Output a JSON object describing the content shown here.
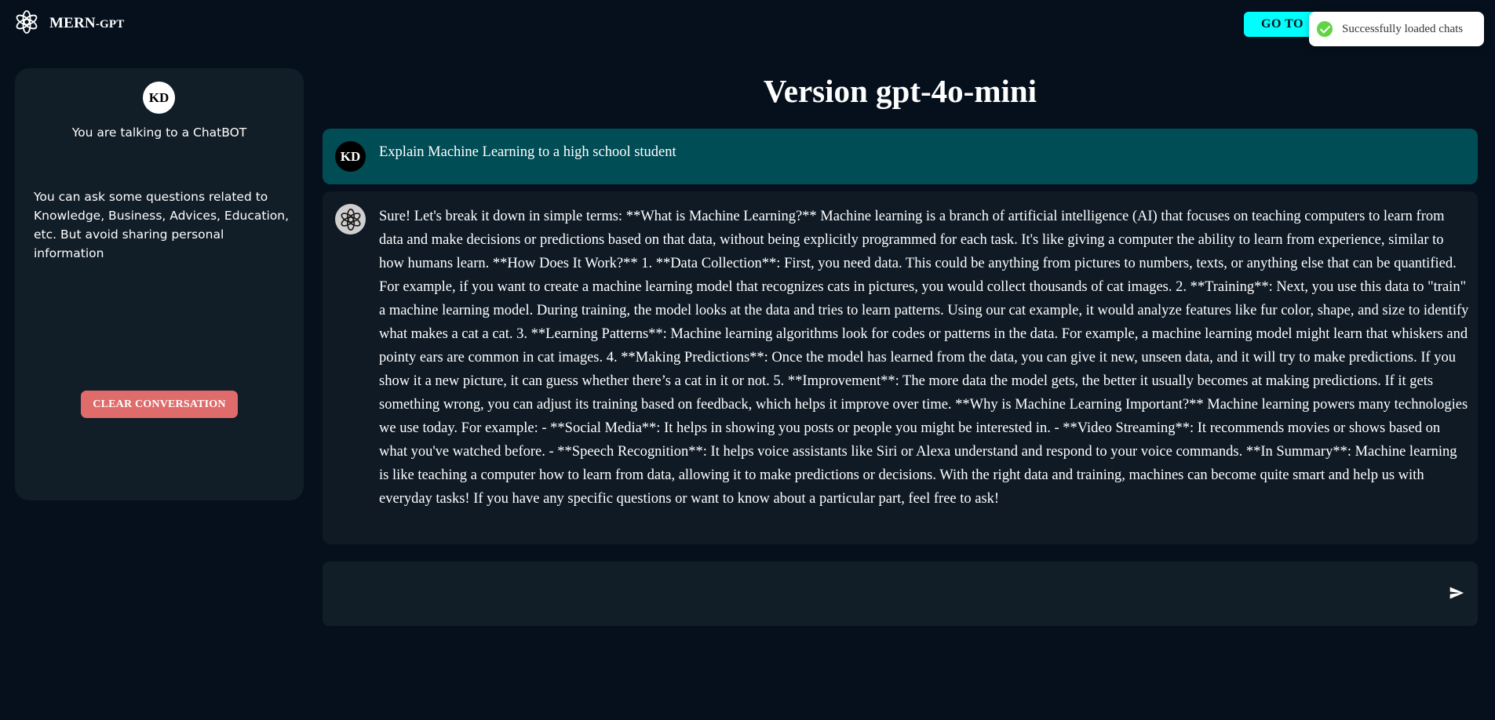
{
  "header": {
    "brand_main": "MERN",
    "brand_sub": "-GPT",
    "goto_button": "GO TO",
    "logo_icon": "openai-logo-icon"
  },
  "toast": {
    "message": "Successfully loaded chats",
    "icon": "check-circle-icon",
    "color": "#61d345"
  },
  "sidebar": {
    "avatar_initials": "KD",
    "title": "You are talking to a ChatBOT",
    "description": "You can ask some questions related to Knowledge, Business, Advices, Education, etc. But avoid sharing personal information",
    "clear_button": "CLEAR CONVERSATION"
  },
  "main": {
    "version_title": "Version gpt-4o-mini",
    "messages": [
      {
        "role": "user",
        "avatar": "KD",
        "text": "Explain Machine Learning to a high school student"
      },
      {
        "role": "assistant",
        "avatar_icon": "openai-logo-icon",
        "text": "Sure! Let's break it down in simple terms: **What is Machine Learning?** Machine learning is a branch of artificial intelligence (AI) that focuses on teaching computers to learn from data and make decisions or predictions based on that data, without being explicitly programmed for each task. It's like giving a computer the ability to learn from experience, similar to how humans learn. **How Does It Work?** 1. **Data Collection**: First, you need data. This could be anything from pictures to numbers, texts, or anything else that can be quantified. For example, if you want to create a machine learning model that recognizes cats in pictures, you would collect thousands of cat images. 2. **Training**: Next, you use this data to \"train\" a machine learning model. During training, the model looks at the data and tries to learn patterns. Using our cat example, it would analyze features like fur color, shape, and size to identify what makes a cat a cat. 3. **Learning Patterns**: Machine learning algorithms look for codes or patterns in the data. For example, a machine learning model might learn that whiskers and pointy ears are common in cat images. 4. **Making Predictions**: Once the model has learned from the data, you can give it new, unseen data, and it will try to make predictions. If you show it a new picture, it can guess whether there’s a cat in it or not. 5. **Improvement**: The more data the model gets, the better it usually becomes at making predictions. If it gets something wrong, you can adjust its training based on feedback, which helps it improve over time. **Why is Machine Learning Important?** Machine learning powers many technologies we use today. For example: - **Social Media**: It helps in showing you posts or people you might be interested in. - **Video Streaming**: It recommends movies or shows based on what you've watched before. - **Speech Recognition**: It helps voice assistants like Siri or Alexa understand and respond to your voice commands. **In Summary**: Machine learning is like teaching a computer how to learn from data, allowing it to make predictions or decisions. With the right data and training, machines can become quite smart and help us with everyday tasks! If you have any specific questions or want to know about a particular part, feel free to ask!"
      }
    ]
  },
  "input": {
    "value": "",
    "placeholder": "",
    "send_icon": "send-icon"
  },
  "colors": {
    "background": "#05101c",
    "panel": "#111d27",
    "user_message": "#004d56",
    "accent_cyan": "#00fffc",
    "clear_button": "#e06b6b"
  }
}
